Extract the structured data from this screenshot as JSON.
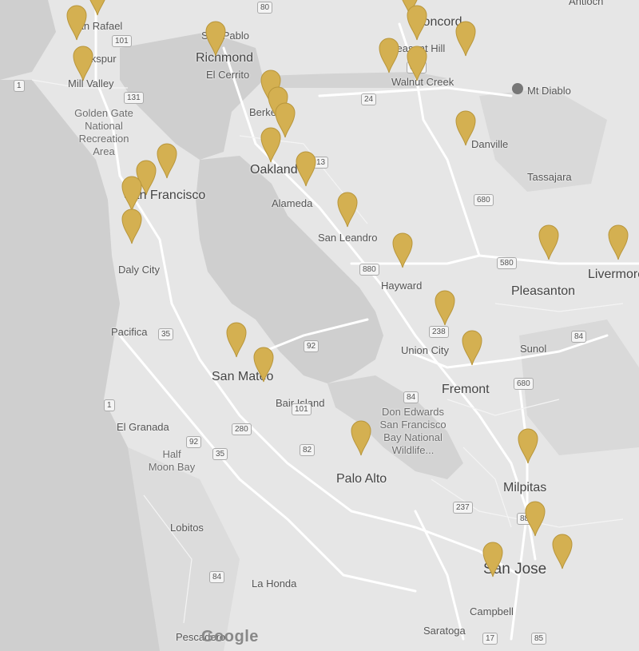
{
  "map": {
    "labels": {
      "san_rafael": "San Rafael",
      "larkspur": "Larkspur",
      "mill_valley": "Mill Valley",
      "golden_gate": "Golden Gate\nNational\nRecreation\nArea",
      "san_pablo": "San Pablo",
      "richmond": "Richmond",
      "el_cerrito": "El Cerrito",
      "concord": "Concord",
      "pleasant_hill": "Pleasant Hill",
      "antioch": "Antioch",
      "mt_diablo": "Mt Diablo",
      "walnut_creek": "Walnut Creek",
      "berkeley": "Berkeley",
      "oakland": "Oakland",
      "alameda": "Alameda",
      "san_francisco": "San Francisco",
      "danville": "Danville",
      "tassajara": "Tassajara",
      "san_leandro": "San Leandro",
      "daly_city": "Daly City",
      "hayward": "Hayward",
      "pleasanton": "Pleasanton",
      "livermore": "Livermore",
      "pacifica": "Pacifica",
      "union_city": "Union City",
      "sunol": "Sunol",
      "san_mateo": "San Mateo",
      "fremont": "Fremont",
      "foster_city": "Bair Island",
      "don_edwards": "Don Edwards\nSan Francisco\nBay National\nWildlife...",
      "el_granada": "El Granada",
      "half_moon_bay": "Half\nMoon Bay",
      "milpitas": "Milpitas",
      "palo_alto": "Palo Alto",
      "lobitos": "Lobitos",
      "la_honda": "La Honda",
      "san_jose": "San Jose",
      "campbell": "Campbell",
      "saratoga": "Saratoga",
      "pescadero": "Pescadero"
    },
    "shields": [
      "101",
      "131",
      "80",
      "680",
      "24",
      "13",
      "880",
      "580",
      "238",
      "84",
      "92",
      "1",
      "35",
      "280",
      "82",
      "237",
      "17",
      "85",
      "84",
      "101",
      "880",
      "680",
      "1",
      "84",
      "35",
      "92",
      "580",
      "680"
    ],
    "attribution": "Google",
    "colors": {
      "pin": "#d4b051",
      "pin_dark": "#b8963c",
      "water": "#c9c9c9",
      "land": "#e8e8e8",
      "road": "#ffffff"
    }
  },
  "markers": [
    {
      "id": "pin-1",
      "lat": 37.98,
      "lng": -122.52
    },
    {
      "id": "pin-2",
      "lat": 37.95,
      "lng": -122.55
    },
    {
      "id": "pin-3",
      "lat": 37.9,
      "lng": -122.54
    },
    {
      "id": "pin-4",
      "lat": 37.93,
      "lng": -122.35
    },
    {
      "id": "pin-5",
      "lat": 37.98,
      "lng": -122.07
    },
    {
      "id": "pin-6",
      "lat": 37.95,
      "lng": -122.06
    },
    {
      "id": "pin-7",
      "lat": 37.93,
      "lng": -121.99
    },
    {
      "id": "pin-8",
      "lat": 37.91,
      "lng": -122.1
    },
    {
      "id": "pin-9",
      "lat": 37.9,
      "lng": -122.06
    },
    {
      "id": "pin-10",
      "lat": 37.87,
      "lng": -122.27
    },
    {
      "id": "pin-11",
      "lat": 37.85,
      "lng": -122.26
    },
    {
      "id": "pin-12",
      "lat": 37.83,
      "lng": -122.25
    },
    {
      "id": "pin-13",
      "lat": 37.8,
      "lng": -122.27
    },
    {
      "id": "pin-14",
      "lat": 37.78,
      "lng": -122.42
    },
    {
      "id": "pin-15",
      "lat": 37.76,
      "lng": -122.45
    },
    {
      "id": "pin-16",
      "lat": 37.74,
      "lng": -122.47
    },
    {
      "id": "pin-17",
      "lat": 37.7,
      "lng": -122.47
    },
    {
      "id": "pin-18",
      "lat": 37.77,
      "lng": -122.22
    },
    {
      "id": "pin-19",
      "lat": 37.72,
      "lng": -122.16
    },
    {
      "id": "pin-20",
      "lat": 37.67,
      "lng": -122.08
    },
    {
      "id": "pin-21",
      "lat": 37.6,
      "lng": -122.02
    },
    {
      "id": "pin-22",
      "lat": 37.55,
      "lng": -121.98
    },
    {
      "id": "pin-23",
      "lat": 37.68,
      "lng": -121.87
    },
    {
      "id": "pin-24",
      "lat": 37.68,
      "lng": -121.77
    },
    {
      "id": "pin-25",
      "lat": 37.82,
      "lng": -121.99
    },
    {
      "id": "pin-26",
      "lat": 37.56,
      "lng": -122.32
    },
    {
      "id": "pin-27",
      "lat": 37.53,
      "lng": -122.28
    },
    {
      "id": "pin-28",
      "lat": 37.44,
      "lng": -122.14
    },
    {
      "id": "pin-29",
      "lat": 37.43,
      "lng": -121.9
    },
    {
      "id": "pin-30",
      "lat": 37.34,
      "lng": -121.89
    },
    {
      "id": "pin-31",
      "lat": 37.29,
      "lng": -121.95
    },
    {
      "id": "pin-32",
      "lat": 37.3,
      "lng": -121.85
    }
  ]
}
